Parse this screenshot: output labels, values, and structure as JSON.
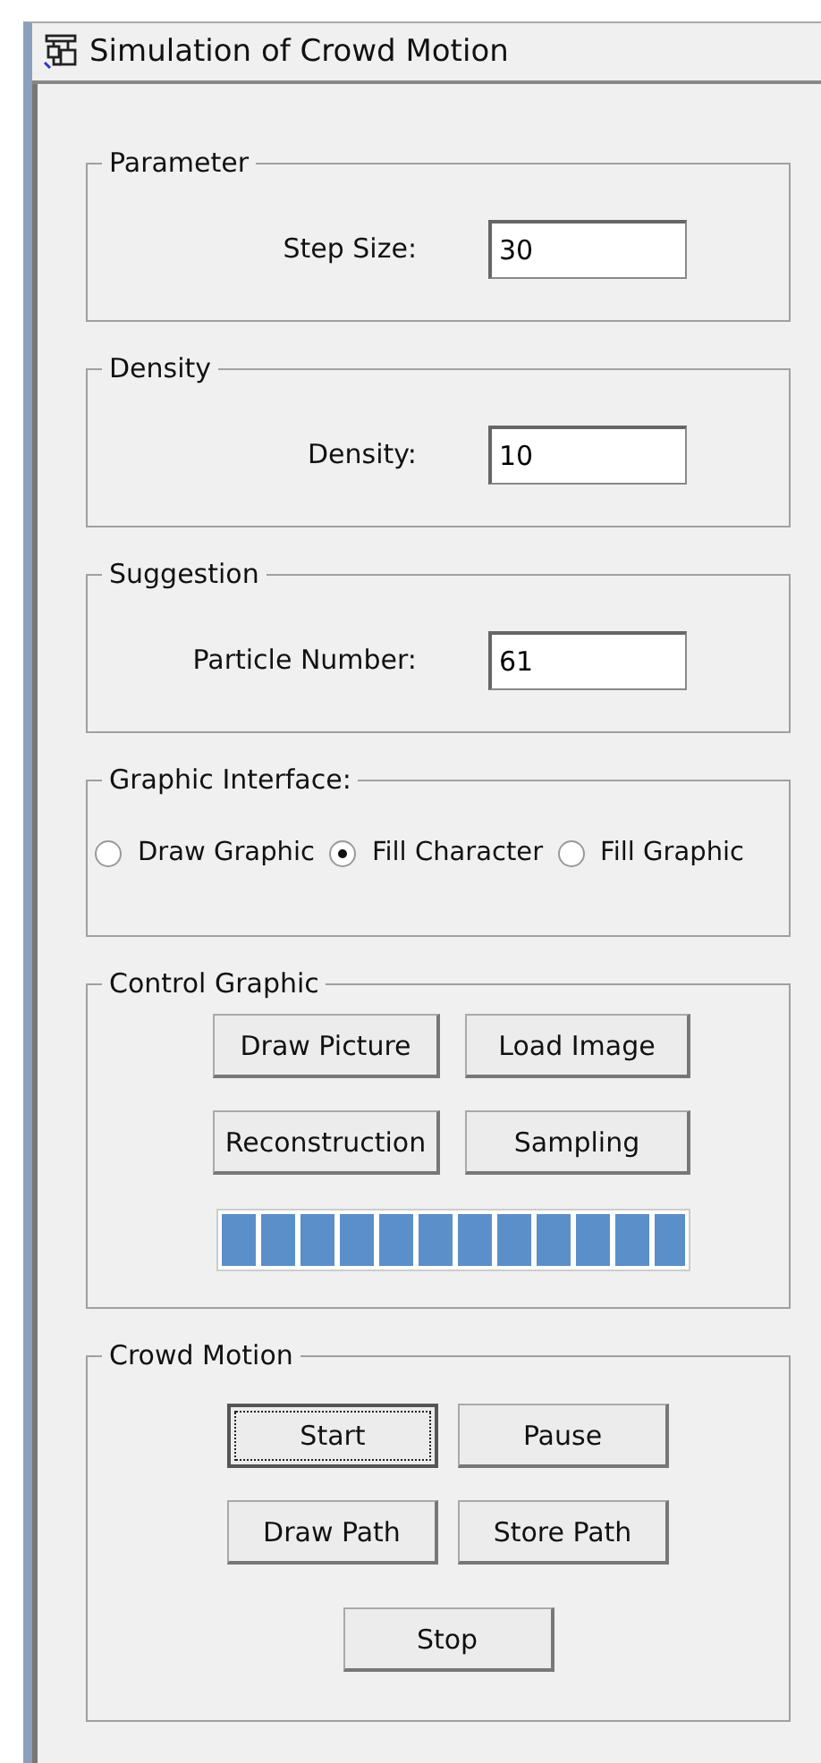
{
  "window": {
    "title": "Simulation of Crowd Motion"
  },
  "groups": [
    {
      "kind": "field",
      "title": "Parameter",
      "label": "Step Size:",
      "value": "30"
    },
    {
      "kind": "field",
      "title": "Density",
      "label": "Density:",
      "value": "10"
    },
    {
      "kind": "field",
      "title": "Suggestion",
      "label": "Particle Number:",
      "value": "61"
    },
    {
      "kind": "radios",
      "title": "Graphic Interface:",
      "options": [
        {
          "label": "Draw Graphic",
          "selected": false
        },
        {
          "label": "Fill Character",
          "selected": true
        },
        {
          "label": "Fill Graphic",
          "selected": false
        }
      ]
    },
    {
      "kind": "control",
      "title": "Control Graphic",
      "buttons": [
        {
          "label": "Draw Picture",
          "focused": false
        },
        {
          "label": "Load Image",
          "focused": false
        },
        {
          "label": "Reconstruction",
          "focused": false
        },
        {
          "label": "Sampling",
          "focused": false
        }
      ],
      "progress": {
        "level": 1.0
      }
    },
    {
      "kind": "motion",
      "title": "Crowd Motion",
      "buttons": [
        {
          "label": "Start",
          "focused": true
        },
        {
          "label": "Pause",
          "focused": false
        },
        {
          "label": "Draw Path",
          "focused": false
        },
        {
          "label": "Store Path",
          "focused": false
        },
        {
          "label": "Stop",
          "focused": false
        }
      ]
    }
  ]
}
